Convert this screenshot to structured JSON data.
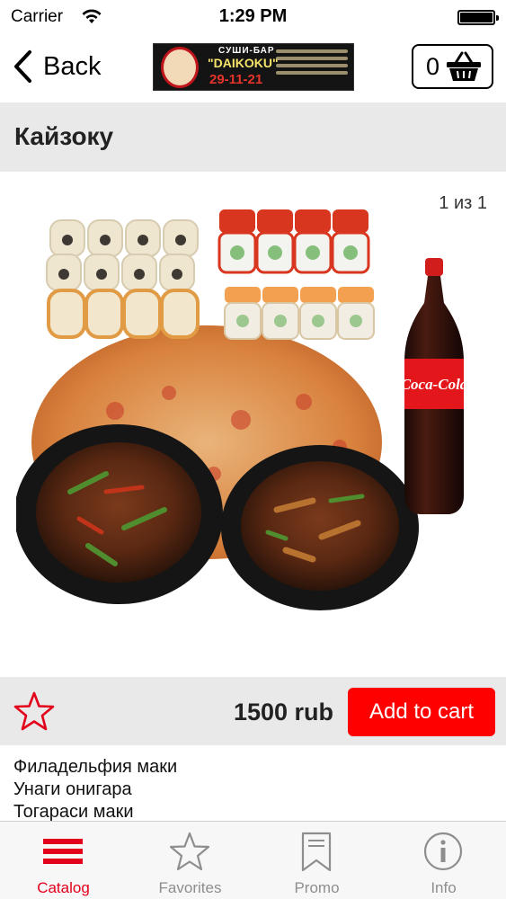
{
  "status_bar": {
    "carrier": "Carrier",
    "time": "1:29 PM"
  },
  "nav": {
    "back_label": "Back",
    "logo": {
      "line1": "СУШИ-БАР",
      "line2": "\"DAIKOKU\"",
      "line3": "29-11-21"
    },
    "cart_count": "0"
  },
  "product": {
    "title": "Кайзоку",
    "image_counter": "1 из 1",
    "bottle_label": "Coca-Cola",
    "price": "1500 rub",
    "add_to_cart_label": "Add to cart",
    "description_lines": [
      "Филадельфия маки",
      "Унаги онигара",
      "Тогараси маки"
    ]
  },
  "tabs": [
    {
      "label": "Catalog",
      "icon": "catalog-icon",
      "active": true
    },
    {
      "label": "Favorites",
      "icon": "star-icon",
      "active": false
    },
    {
      "label": "Promo",
      "icon": "bookmark-icon",
      "active": false
    },
    {
      "label": "Info",
      "icon": "info-icon",
      "active": false
    }
  ],
  "colors": {
    "accent": "#fe0000",
    "tab_active": "#e3001b",
    "tab_inactive": "#8e8e8e",
    "bar_bg": "#e9e9e9"
  }
}
